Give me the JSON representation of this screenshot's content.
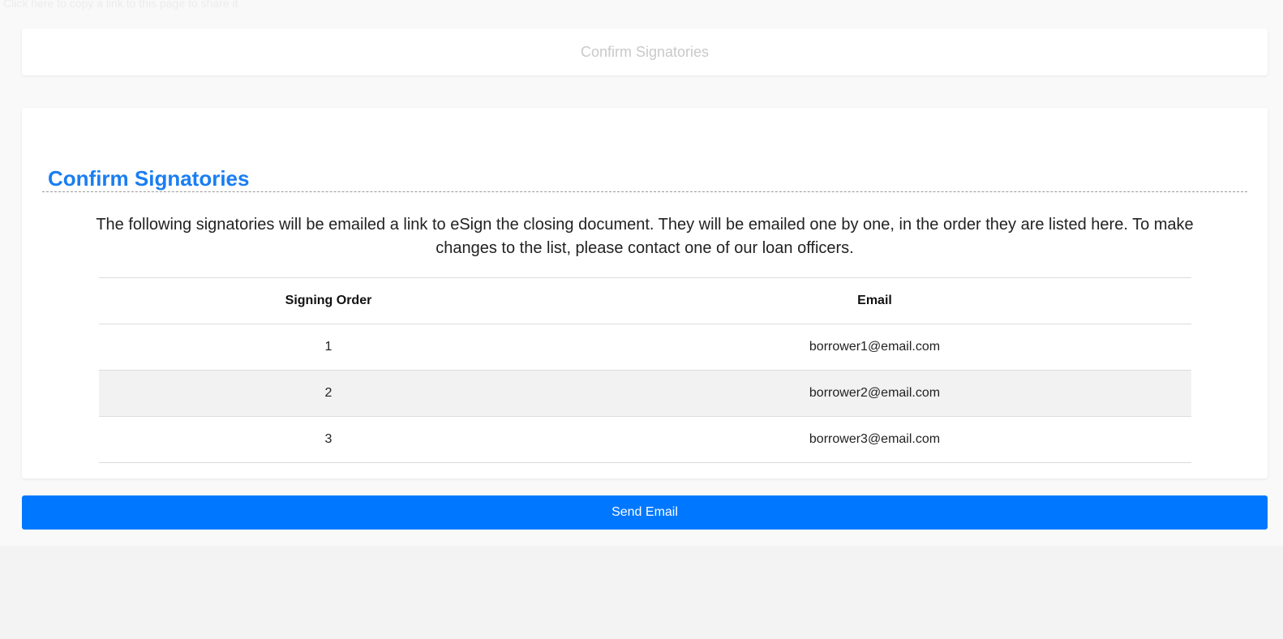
{
  "top_bar": {
    "faded_text": "Click here to copy a link to this page to share it"
  },
  "step_header": {
    "title": "Confirm Signatories"
  },
  "main": {
    "title": "Confirm Signatories",
    "intro": "The following signatories will be emailed a link to eSign the closing document. They will be emailed one by one, in the order they are listed here. To make changes to the list, please contact one of our loan officers.",
    "table": {
      "headers": [
        "Signing Order",
        "Email"
      ],
      "rows": [
        {
          "order": "1",
          "email": "borrower1@email.com"
        },
        {
          "order": "2",
          "email": "borrower2@email.com"
        },
        {
          "order": "3",
          "email": "borrower3@email.com"
        }
      ]
    }
  },
  "actions": {
    "send_label": "Send Email"
  },
  "colors": {
    "accent": "#0077ff",
    "title": "#1a7ef2",
    "stripe": "#f2f2f2"
  }
}
